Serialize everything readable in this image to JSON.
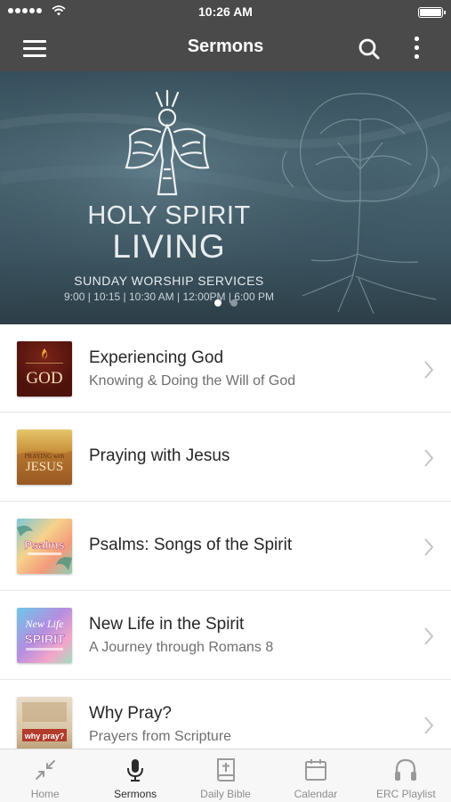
{
  "status_bar": {
    "time": "10:26 AM"
  },
  "header": {
    "title": "Sermons"
  },
  "banner": {
    "title_line1": "HOLY SPIRIT",
    "title_line2": "LIVING",
    "subtitle": "SUNDAY WORSHIP SERVICES",
    "times": "9:00 | 10:15 | 10:30 AM | 12:00PM | 6:00 PM",
    "page_count": 2,
    "active_page": 1
  },
  "sermons": [
    {
      "title": "Experiencing God",
      "subtitle": "Knowing & Doing the Will of God",
      "thumb_text": "GOD"
    },
    {
      "title": "Praying with Jesus",
      "subtitle": "",
      "thumb_text": "JESUS"
    },
    {
      "title": "Psalms: Songs of the Spirit",
      "subtitle": "",
      "thumb_text": "Psalms"
    },
    {
      "title": "New Life in the Spirit",
      "subtitle": "A Journey through Romans 8",
      "thumb_text": "SPIRIT"
    },
    {
      "title": "Why Pray?",
      "subtitle": "Prayers from Scripture",
      "thumb_text": "why pray?"
    }
  ],
  "tabs": [
    {
      "label": "Home",
      "icon": "collapse-arrows-icon"
    },
    {
      "label": "Sermons",
      "icon": "microphone-icon",
      "active": true
    },
    {
      "label": "Daily Bible",
      "icon": "bible-icon"
    },
    {
      "label": "Calendar",
      "icon": "calendar-icon"
    },
    {
      "label": "ERC Playlist",
      "icon": "headphones-icon"
    }
  ],
  "colors": {
    "header_bg": "#4a4a4a",
    "tab_active": "#2b2b2b",
    "tab_inactive": "#8e8e8e"
  }
}
